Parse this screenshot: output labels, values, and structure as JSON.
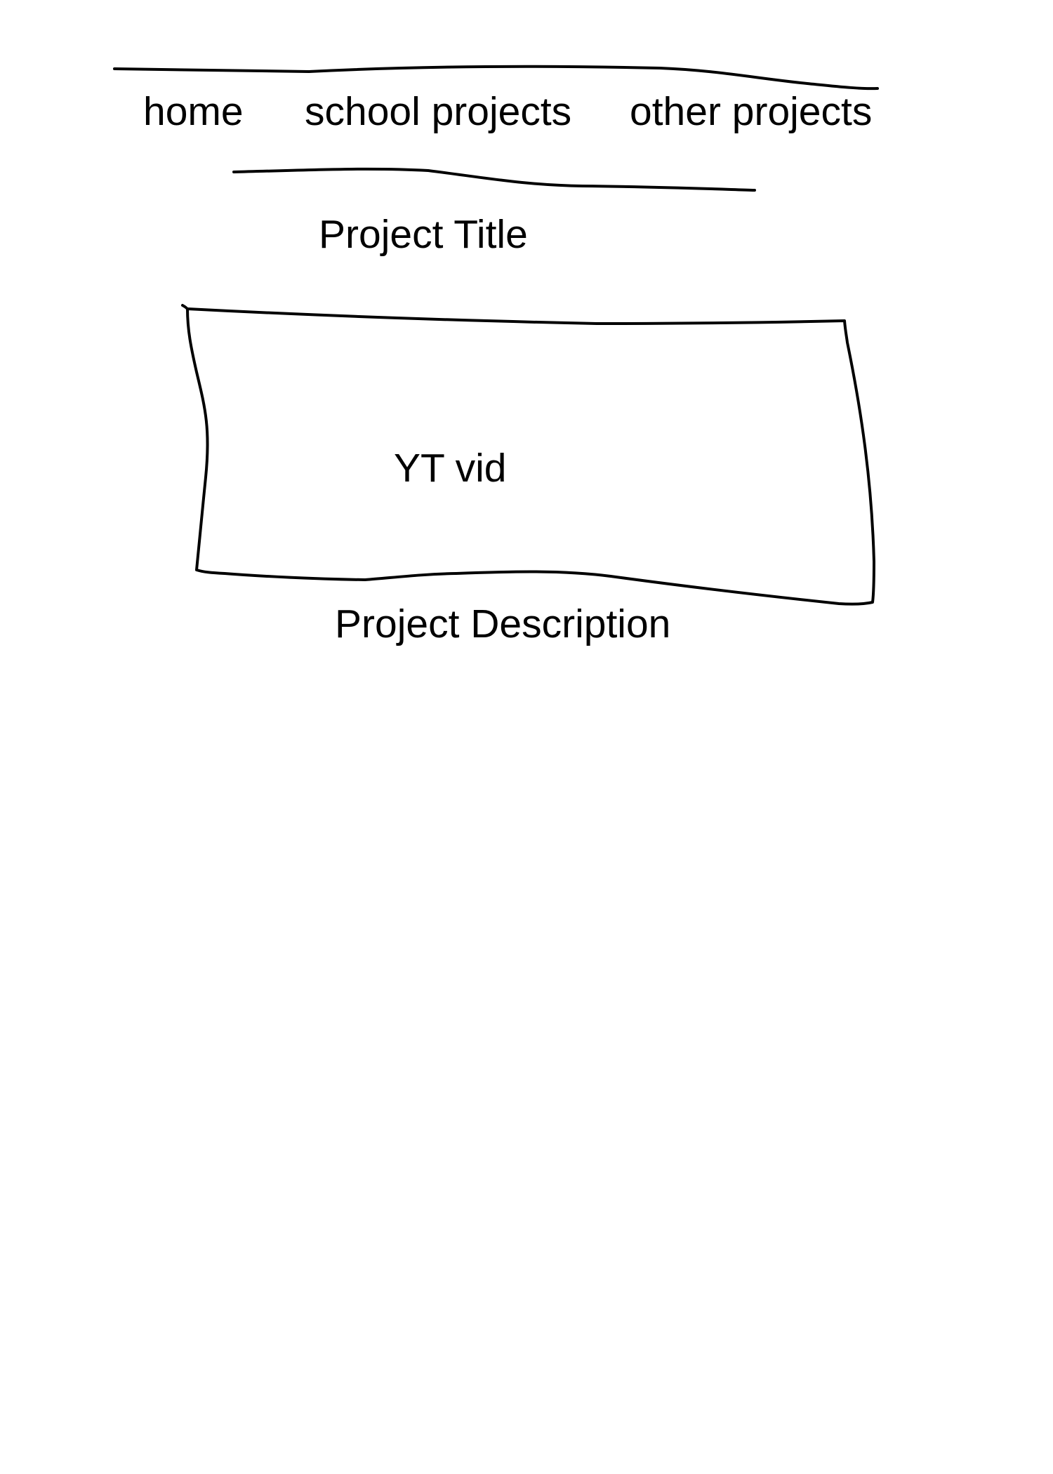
{
  "nav": {
    "items": [
      {
        "label": "home"
      },
      {
        "label": "school projects"
      },
      {
        "label": "other projects"
      }
    ]
  },
  "project": {
    "title": "Project Title",
    "video_placeholder": "YT vid",
    "description": "Project Description"
  },
  "colors": {
    "ink": "#000000",
    "paper": "#ffffff"
  }
}
